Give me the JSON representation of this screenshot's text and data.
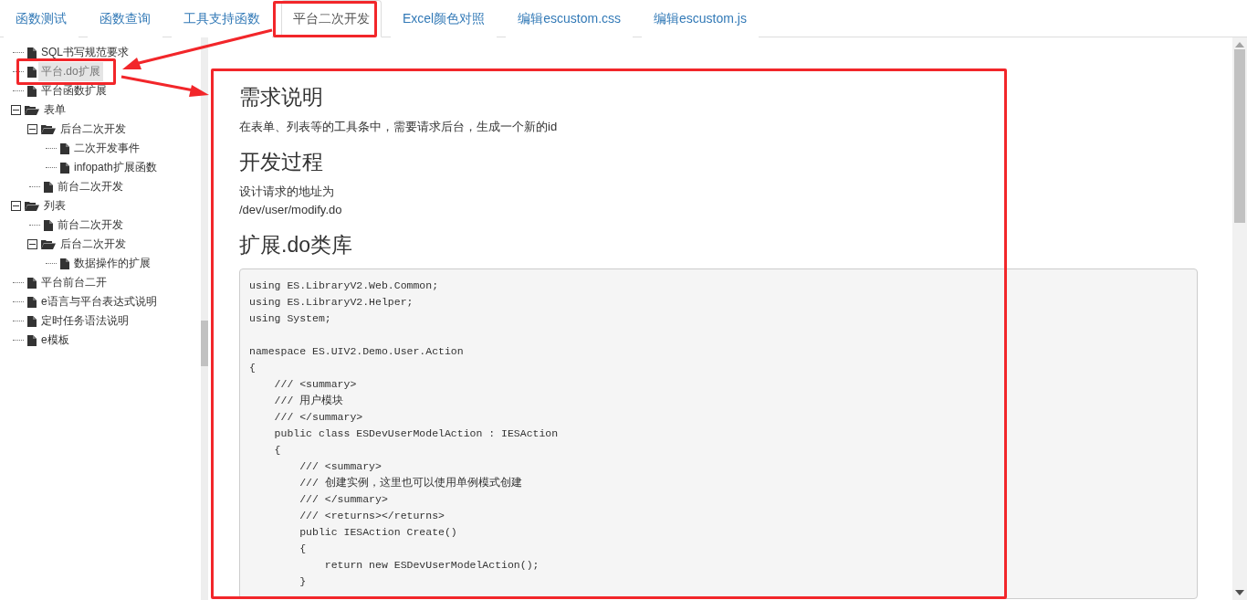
{
  "tabs": [
    {
      "label": "函数测试",
      "selected": false
    },
    {
      "label": "函数查询",
      "selected": false
    },
    {
      "label": "工具支持函数",
      "selected": false
    },
    {
      "label": "平台二次开发",
      "selected": true
    },
    {
      "label": "Excel颜色对照",
      "selected": false
    },
    {
      "label": "编辑escustom.css",
      "selected": false
    },
    {
      "label": "编辑escustom.js",
      "selected": false
    }
  ],
  "tree": [
    {
      "label": "SQL书写规范要求",
      "kind": "file",
      "selected": false
    },
    {
      "label": "平台.do扩展",
      "kind": "file",
      "selected": true
    },
    {
      "label": "平台函数扩展",
      "kind": "file",
      "selected": false
    },
    {
      "label": "表单",
      "kind": "folder",
      "expanded": true,
      "selected": false,
      "children": [
        {
          "label": "后台二次开发",
          "kind": "folder",
          "expanded": true,
          "selected": false,
          "children": [
            {
              "label": "二次开发事件",
              "kind": "file",
              "selected": false
            },
            {
              "label": "infopath扩展函数",
              "kind": "file",
              "selected": false
            }
          ]
        },
        {
          "label": "前台二次开发",
          "kind": "file",
          "selected": false
        }
      ]
    },
    {
      "label": "列表",
      "kind": "folder",
      "expanded": true,
      "selected": false,
      "children": [
        {
          "label": "前台二次开发",
          "kind": "file",
          "selected": false
        },
        {
          "label": "后台二次开发",
          "kind": "folder",
          "expanded": true,
          "selected": false,
          "children": [
            {
              "label": "数据操作的扩展",
              "kind": "file",
              "selected": false
            }
          ]
        }
      ]
    },
    {
      "label": "平台前台二开",
      "kind": "file",
      "selected": false
    },
    {
      "label": "e语言与平台表达式说明",
      "kind": "file",
      "selected": false
    },
    {
      "label": "定时任务语法说明",
      "kind": "file",
      "selected": false
    },
    {
      "label": "e模板",
      "kind": "file",
      "selected": false
    }
  ],
  "article": [
    {
      "kind": "heading",
      "text": "需求说明"
    },
    {
      "kind": "paragraph",
      "text": "在表单、列表等的工具条中，需要请求后台，生成一个新的id"
    },
    {
      "kind": "heading",
      "text": "开发过程"
    },
    {
      "kind": "paragraph",
      "text": "设计请求的地址为"
    },
    {
      "kind": "paragraph",
      "text": "/dev/user/modify.do"
    },
    {
      "kind": "heading",
      "text": "扩展.do类库"
    },
    {
      "kind": "code",
      "text": "using ES.LibraryV2.Web.Common;\nusing ES.LibraryV2.Helper;\nusing System;\n\nnamespace ES.UIV2.Demo.User.Action\n{\n    /// <summary>\n    /// 用户模块\n    /// </summary>\n    public class ESDevUserModelAction : IESAction\n    {\n        /// <summary>\n        /// 创建实例，这里也可以使用单例模式创建\n        /// </summary>\n        /// <returns></returns>\n        public IESAction Create()\n        {\n            return new ESDevUserModelAction();\n        }"
    }
  ]
}
